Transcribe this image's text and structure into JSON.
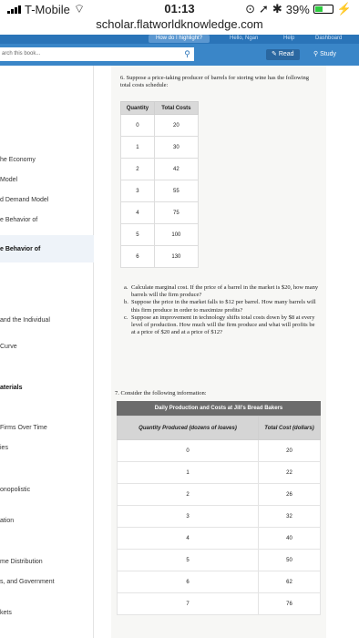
{
  "status": {
    "carrier": "T-Mobile",
    "time": "01:13",
    "battery": "39%"
  },
  "url": "scholar.flatworldknowledge.com",
  "topnav": {
    "highlight": "How do I highlight?",
    "hello": "Hello, Ngan",
    "help": "Help",
    "dashboard": "Dashboard"
  },
  "toolbar": {
    "search_placeholder": "arch this book...",
    "read": "Read",
    "study": "Study"
  },
  "sidebar": [
    {
      "label": "he Economy",
      "bold": false
    },
    {
      "label": "Model",
      "bold": false
    },
    {
      "label": "d Demand Model",
      "bold": false
    },
    {
      "label": "e Behavior of",
      "bold": false
    },
    {
      "label": "e Behavior of",
      "bold": true
    },
    {
      "label": "and the Individual",
      "bold": false
    },
    {
      "label": "Curve",
      "bold": false
    },
    {
      "label": "aterials",
      "bold": true
    },
    {
      "label": "Firms Over Time",
      "bold": false
    },
    {
      "label": "ies",
      "bold": false
    },
    {
      "label": "onopolistic",
      "bold": false
    },
    {
      "label": "ation",
      "bold": false
    },
    {
      "label": "me Distribution",
      "bold": false
    },
    {
      "label": "s, and Government",
      "bold": false
    },
    {
      "label": "kets",
      "bold": false
    }
  ],
  "q6": {
    "text": "6. Suppose a price-taking producer of barrels for storing wine has the following total costs schedule:",
    "headers": [
      "Quantity",
      "Total Costs"
    ],
    "rows": [
      [
        "0",
        "20"
      ],
      [
        "1",
        "30"
      ],
      [
        "2",
        "42"
      ],
      [
        "3",
        "55"
      ],
      [
        "4",
        "75"
      ],
      [
        "5",
        "100"
      ],
      [
        "6",
        "130"
      ]
    ]
  },
  "subquestions": [
    {
      "letter": "a.",
      "text": "Calculate marginal cost. If the price of a barrel in the market is $20, how many barrels will the firm produce?"
    },
    {
      "letter": "b.",
      "text": "Suppose the price in the market falls to $12 per barrel. How many barrels will this firm produce in order to maximize profits?"
    },
    {
      "letter": "c.",
      "text": "Suppose an improvement in technology shifts total costs down by $8 at every level of production. How much will the firm produce and what will profits be at a price of $20 and at a price of $12?"
    }
  ],
  "q7": {
    "text": "7. Consider the following information:",
    "caption": "Daily Production and Costs at Jill's Bread Bakers",
    "headers": [
      "Quantity Produced (dozens of loaves)",
      "Total Cost (dollars)"
    ],
    "rows": [
      [
        "0",
        "20"
      ],
      [
        "1",
        "22"
      ],
      [
        "2",
        "26"
      ],
      [
        "3",
        "32"
      ],
      [
        "4",
        "40"
      ],
      [
        "5",
        "50"
      ],
      [
        "6",
        "62"
      ],
      [
        "7",
        "76"
      ]
    ]
  }
}
